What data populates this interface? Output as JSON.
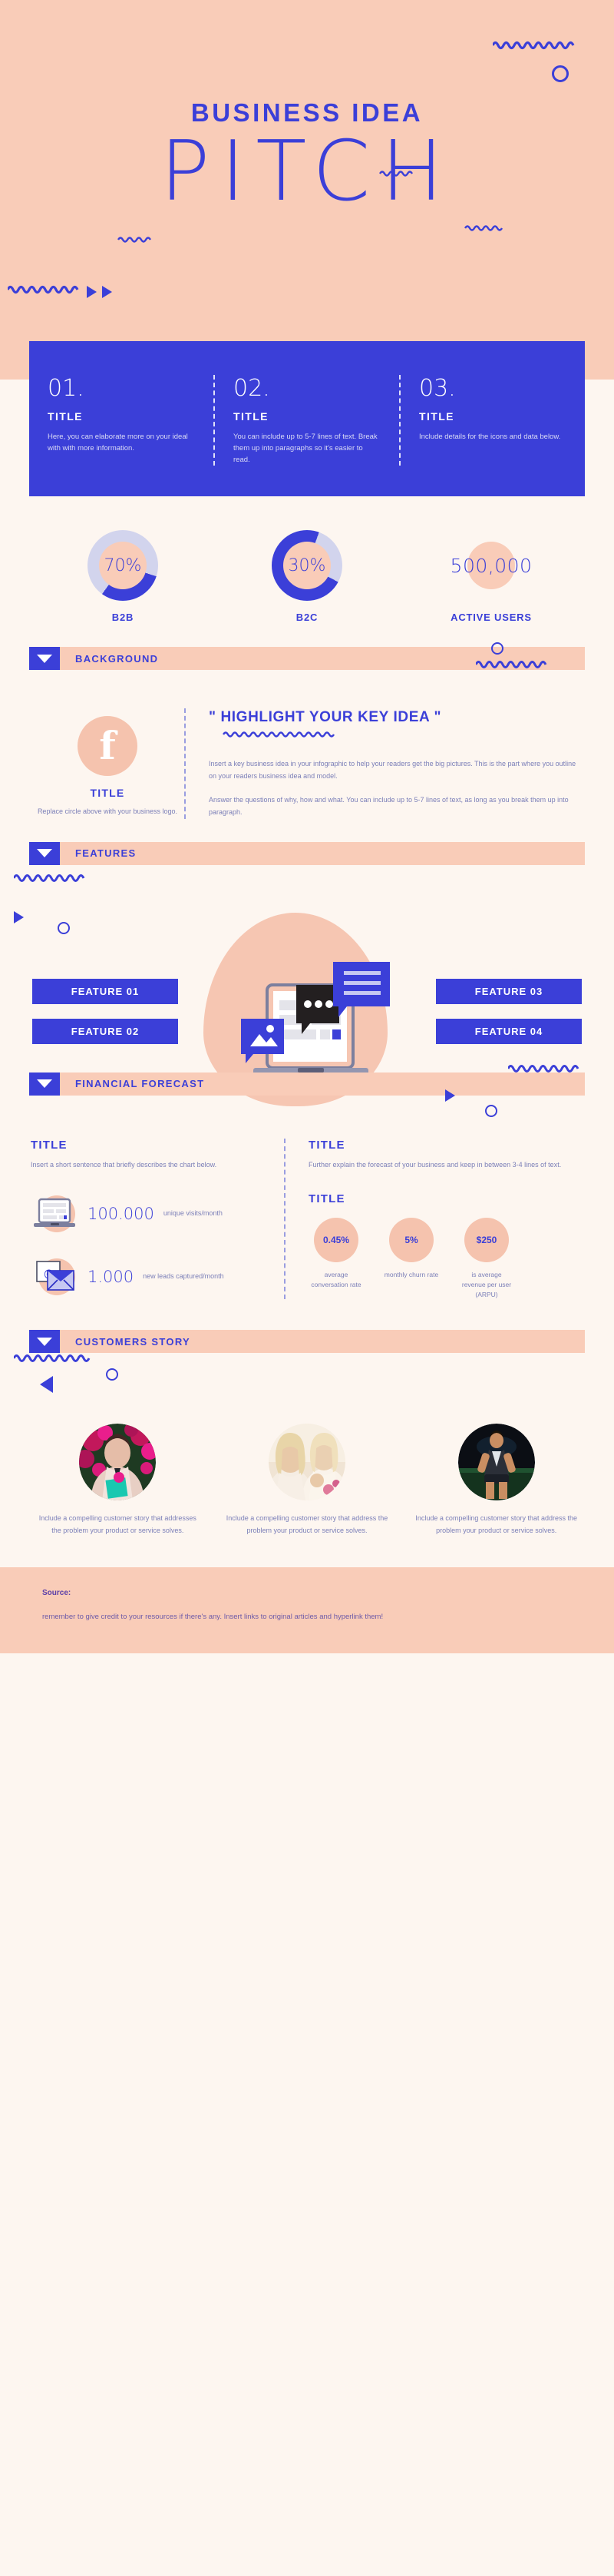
{
  "hero": {
    "eyebrow": "BUSINESS IDEA",
    "title": "PITCH"
  },
  "steps": [
    {
      "number": "01.",
      "title": "TITLE",
      "body": "Here, you can elaborate more on your ideal with with more information."
    },
    {
      "number": "02.",
      "title": "TITLE",
      "body": "You can include up to 5-7 lines of text. Break them up into paragraphs so it's easier to read."
    },
    {
      "number": "03.",
      "title": "TITLE",
      "body": "Include details for the icons and data below."
    }
  ],
  "stats": [
    {
      "value": "70%",
      "label": "B2B"
    },
    {
      "value": "30%",
      "label": "B2C"
    },
    {
      "value": "500,000",
      "label": "ACTIVE USERS"
    }
  ],
  "sections": {
    "background": "BACKGROUND",
    "features": "FEATURES",
    "financial": "FINANCIAL FORECAST",
    "customers": "CUSTOMERS STORY"
  },
  "background": {
    "icon_name": "facebook-icon",
    "left_title": "TITLE",
    "left_body": "Replace circle above with your business logo.",
    "quote": "\" HIGHLIGHT YOUR KEY IDEA \"",
    "paragraph1": "Insert a key business idea in your infographic to help your readers get the big pictures. This is the part where you outline on your readers business idea and model.",
    "paragraph2": "Answer the questions of why, how and what. You can include up to 5-7 lines of text, as long as you break them up into paragraph."
  },
  "features": [
    "FEATURE 01",
    "FEATURE 02",
    "FEATURE 03",
    "FEATURE 04"
  ],
  "financial": {
    "left_title": "TITLE",
    "left_desc": "Insert a short sentence that briefly describes the chart below.",
    "metrics": [
      {
        "icon": "laptop-icon",
        "value": "100.000",
        "unit": "unique visits/month"
      },
      {
        "icon": "email-icon",
        "value": "1.000",
        "unit": "new leads captured/month"
      }
    ],
    "right_title": "TITLE",
    "right_desc": "Further explain the forecast of your business and keep in between 3-4 lines of text.",
    "sub_title": "TITLE",
    "pills": [
      {
        "value": "0.45%",
        "label": "average conversation rate"
      },
      {
        "value": "5%",
        "label": "monthly churn rate"
      },
      {
        "value": "$250",
        "label": "is average revenue per user (ARPU)"
      }
    ]
  },
  "customers": [
    {
      "photo": "woman-with-flowers-photo",
      "text": "Include a compelling customer story that addresses the problem your product or service solves."
    },
    {
      "photo": "two-women-laughing-photo",
      "text": "Include a compelling customer story that address the problem your product or service solves."
    },
    {
      "photo": "athlete-runner-photo",
      "text": "Include a compelling customer story that address the problem your product or service solves."
    }
  ],
  "footer": {
    "source_label": "Source:",
    "source_text": "remember to give credit to your resources if there's any. Insert links to original articles and hyperlink them!"
  },
  "colors": {
    "blue": "#3B3FD8",
    "peach": "#F9CCB8",
    "cream": "#FDF6F0",
    "lavender": "#D2D4ED"
  },
  "chart_data": {
    "type": "pie",
    "title": "Customer segment split",
    "series": [
      {
        "name": "B2B",
        "value": 70,
        "unit": "%",
        "ring_filled_pct": 30,
        "ring_color": "#3B3FD8",
        "track_color": "#D2D4ED"
      },
      {
        "name": "B2C",
        "value": 30,
        "unit": "%",
        "ring_filled_pct": 72,
        "ring_color": "#3B3FD8",
        "track_color": "#D2D4ED"
      }
    ],
    "extra_metrics": [
      {
        "name": "ACTIVE USERS",
        "value": 500000,
        "display": "500,000"
      },
      {
        "name": "unique visits/month",
        "value": 100000,
        "display": "100.000"
      },
      {
        "name": "new leads captured/month",
        "value": 1000,
        "display": "1.000"
      },
      {
        "name": "average conversation rate",
        "value": 0.45,
        "display": "0.45%"
      },
      {
        "name": "monthly churn rate",
        "value": 5,
        "display": "5%"
      },
      {
        "name": "average revenue per user (ARPU)",
        "value": 250,
        "display": "$250"
      }
    ]
  }
}
